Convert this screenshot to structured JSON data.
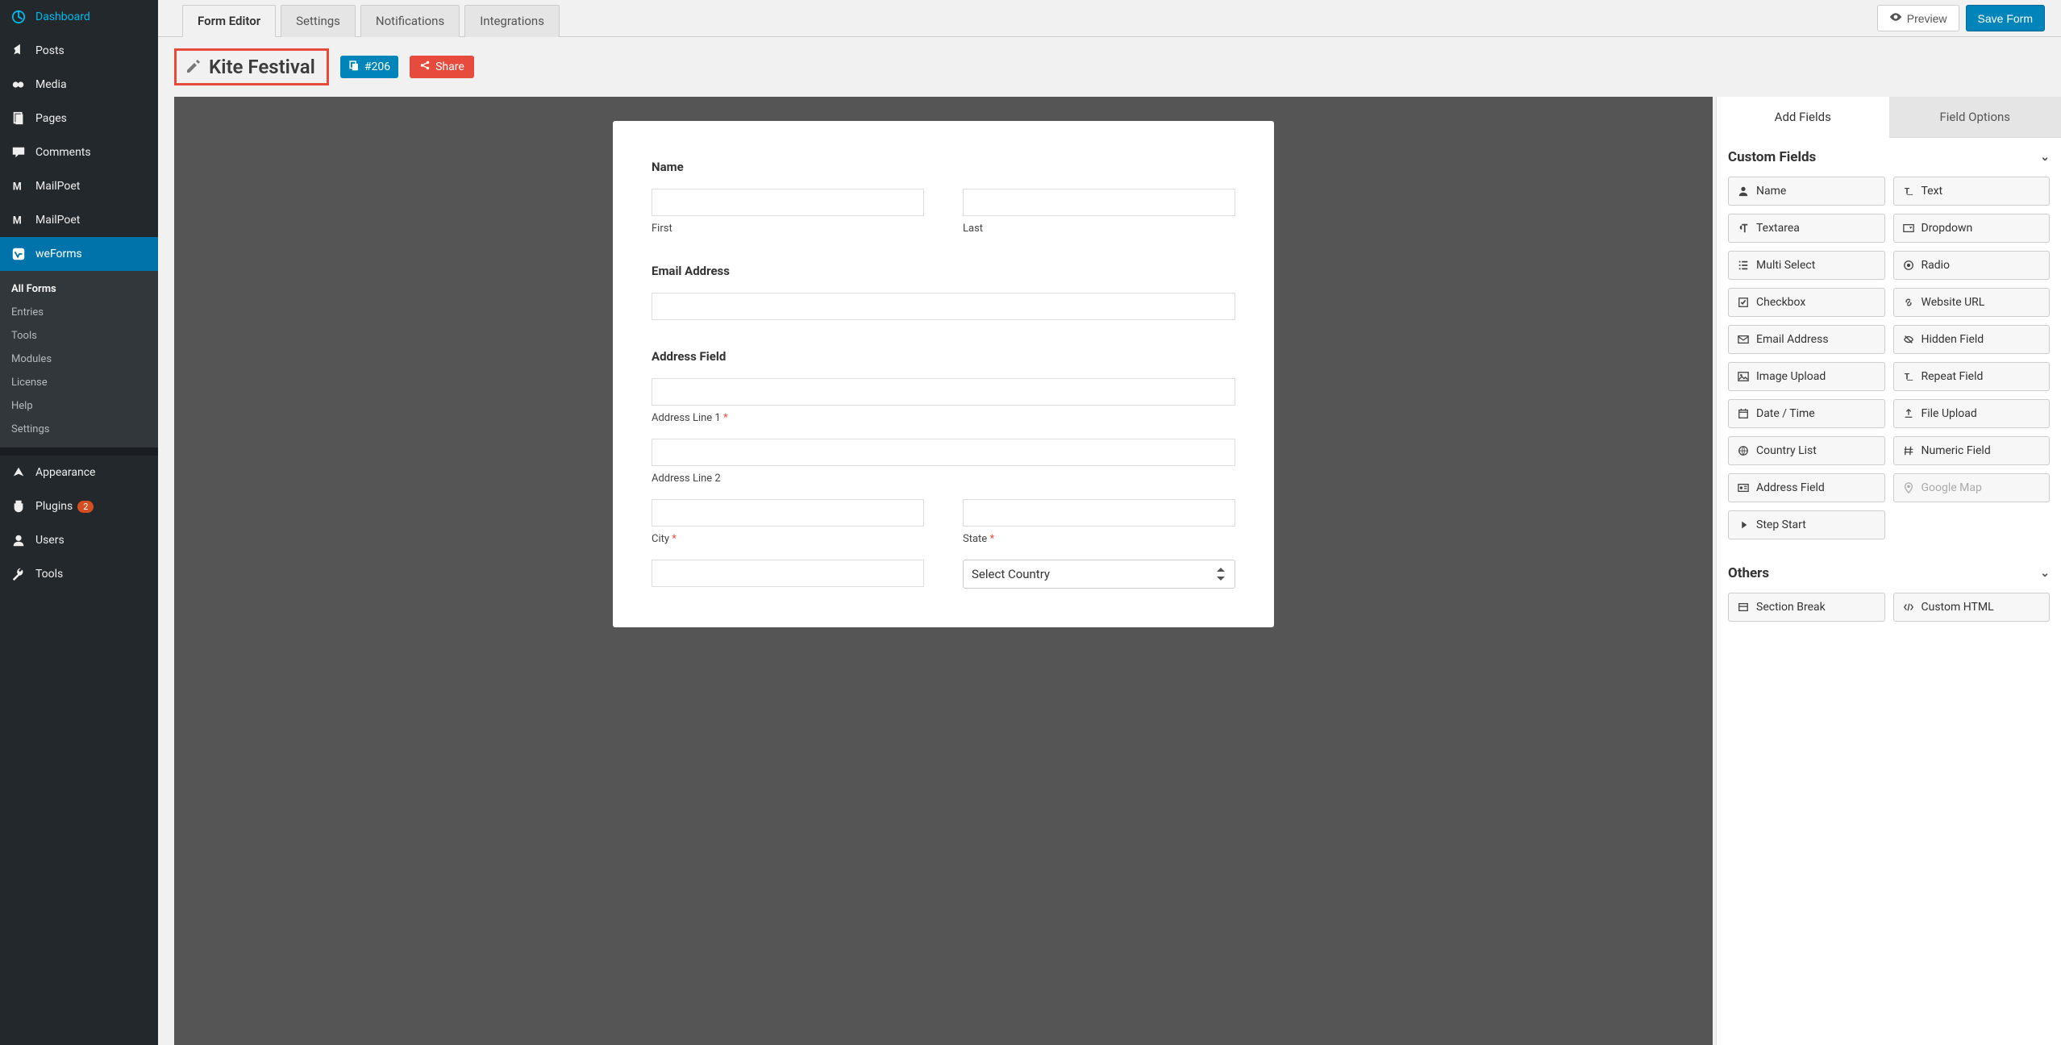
{
  "sidebar": {
    "items": [
      {
        "icon": "dashboard",
        "label": "Dashboard"
      },
      {
        "icon": "pin",
        "label": "Posts"
      },
      {
        "icon": "media",
        "label": "Media"
      },
      {
        "icon": "page",
        "label": "Pages"
      },
      {
        "icon": "comment",
        "label": "Comments"
      },
      {
        "icon": "mailpoet",
        "label": "MailPoet"
      },
      {
        "icon": "mailpoet",
        "label": "MailPoet"
      },
      {
        "icon": "weforms",
        "label": "weForms"
      }
    ],
    "subitems": [
      {
        "label": "All Forms",
        "active": true
      },
      {
        "label": "Entries"
      },
      {
        "label": "Tools"
      },
      {
        "label": "Modules"
      },
      {
        "label": "License"
      },
      {
        "label": "Help"
      },
      {
        "label": "Settings"
      }
    ],
    "items2": [
      {
        "icon": "appearance",
        "label": "Appearance"
      },
      {
        "icon": "plugins",
        "label": "Plugins",
        "badge": "2"
      },
      {
        "icon": "users",
        "label": "Users"
      },
      {
        "icon": "tools",
        "label": "Tools"
      }
    ]
  },
  "tabs": [
    {
      "label": "Form Editor",
      "active": true
    },
    {
      "label": "Settings"
    },
    {
      "label": "Notifications"
    },
    {
      "label": "Integrations"
    }
  ],
  "topbar": {
    "preview": "Preview",
    "save": "Save Form"
  },
  "titlebar": {
    "title": "Kite Festival",
    "id_badge": "#206",
    "share": "Share"
  },
  "form": {
    "name_label": "Name",
    "first_sub": "First",
    "last_sub": "Last",
    "email_label": "Email Address",
    "address_label": "Address Field",
    "addr1": "Address Line 1",
    "addr2": "Address Line 2",
    "city": "City",
    "state": "State",
    "country_placeholder": "Select Country"
  },
  "right_panel": {
    "tab_add": "Add Fields",
    "tab_opts": "Field Options",
    "section_custom": "Custom Fields",
    "section_others": "Others",
    "fields": [
      {
        "icon": "user",
        "label": "Name"
      },
      {
        "icon": "text",
        "label": "Text"
      },
      {
        "icon": "para",
        "label": "Textarea"
      },
      {
        "icon": "caret",
        "label": "Dropdown"
      },
      {
        "icon": "list",
        "label": "Multi Select"
      },
      {
        "icon": "radio",
        "label": "Radio"
      },
      {
        "icon": "check",
        "label": "Checkbox"
      },
      {
        "icon": "link",
        "label": "Website URL"
      },
      {
        "icon": "mail",
        "label": "Email Address"
      },
      {
        "icon": "hidden",
        "label": "Hidden Field"
      },
      {
        "icon": "image",
        "label": "Image Upload"
      },
      {
        "icon": "repeat",
        "label": "Repeat Field"
      },
      {
        "icon": "date",
        "label": "Date / Time"
      },
      {
        "icon": "upload",
        "label": "File Upload"
      },
      {
        "icon": "globe",
        "label": "Country List"
      },
      {
        "icon": "hash",
        "label": "Numeric Field"
      },
      {
        "icon": "address",
        "label": "Address Field"
      },
      {
        "icon": "map",
        "label": "Google Map",
        "disabled": true
      },
      {
        "icon": "step",
        "label": "Step Start"
      }
    ],
    "others_fields": [
      {
        "icon": "section",
        "label": "Section Break"
      },
      {
        "icon": "html",
        "label": "Custom HTML"
      }
    ]
  }
}
